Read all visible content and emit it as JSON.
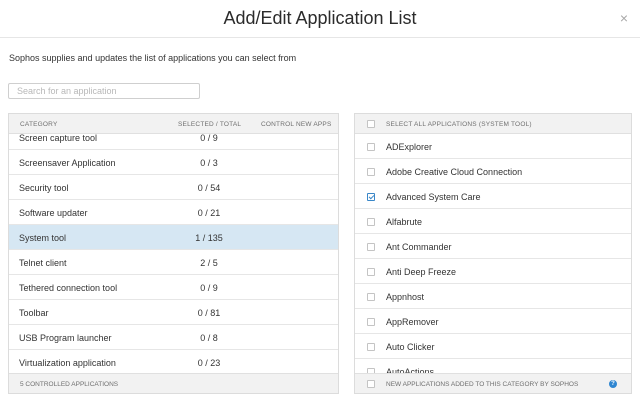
{
  "modal": {
    "title": "Add/Edit Application List",
    "close_glyph": "×"
  },
  "intro": "Sophos supplies and updates the list of applications you can select from",
  "search": {
    "placeholder": "Search for an application",
    "value": ""
  },
  "left_panel": {
    "headers": {
      "category": "CATEGORY",
      "selected_total": "SELECTED / TOTAL",
      "control_new": "CONTROL NEW APPS"
    },
    "rows": [
      {
        "name": "Screen capture tool",
        "count": "0 / 9",
        "selected": false
      },
      {
        "name": "Screensaver Application",
        "count": "0 / 3",
        "selected": false
      },
      {
        "name": "Security tool",
        "count": "0 / 54",
        "selected": false
      },
      {
        "name": "Software updater",
        "count": "0 / 21",
        "selected": false
      },
      {
        "name": "System tool",
        "count": "1 / 135",
        "selected": true
      },
      {
        "name": "Telnet client",
        "count": "2 / 5",
        "selected": false
      },
      {
        "name": "Tethered connection tool",
        "count": "0 / 9",
        "selected": false
      },
      {
        "name": "Toolbar",
        "count": "0 / 81",
        "selected": false
      },
      {
        "name": "USB Program launcher",
        "count": "0 / 8",
        "selected": false
      },
      {
        "name": "Virtualization application",
        "count": "0 / 23",
        "selected": false
      }
    ],
    "footer": "5 CONTROLLED APPLICATIONS"
  },
  "right_panel": {
    "header": "SELECT ALL APPLICATIONS (SYSTEM TOOL)",
    "apps": [
      {
        "name": "ADExplorer",
        "checked": false
      },
      {
        "name": "Adobe Creative Cloud Connection",
        "checked": false
      },
      {
        "name": "Advanced System Care",
        "checked": true
      },
      {
        "name": "Alfabrute",
        "checked": false
      },
      {
        "name": "Ant Commander",
        "checked": false
      },
      {
        "name": "Anti Deep Freeze",
        "checked": false
      },
      {
        "name": "Appnhost",
        "checked": false
      },
      {
        "name": "AppRemover",
        "checked": false
      },
      {
        "name": "Auto Clicker",
        "checked": false
      },
      {
        "name": "AutoActions",
        "checked": false
      }
    ],
    "footer": "NEW APPLICATIONS ADDED TO THIS CATEGORY BY SOPHOS",
    "help_glyph": "?"
  },
  "colors": {
    "selected_row": "#d6e7f3",
    "accent": "#2f86d1"
  }
}
